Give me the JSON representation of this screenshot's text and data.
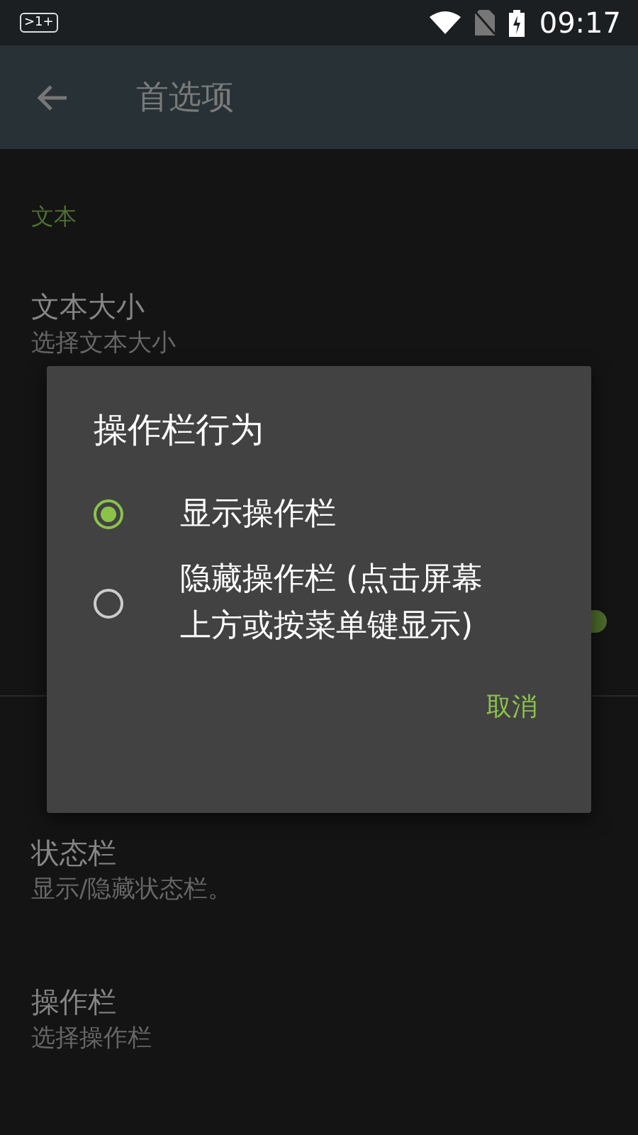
{
  "status_bar": {
    "notification_badge": ">1+",
    "time": "09:17"
  },
  "app_bar": {
    "title": "首选项"
  },
  "sections": [
    {
      "header": "文本",
      "items": [
        {
          "title": "文本大小",
          "subtitle": "选择文本大小"
        },
        {
          "switch": {
            "on": true
          }
        }
      ]
    },
    {
      "items": [
        {
          "title": "状态栏",
          "subtitle": "显示/隐藏状态栏。"
        },
        {
          "title": "操作栏",
          "subtitle": "选择操作栏"
        }
      ]
    }
  ],
  "dialog": {
    "title": "操作栏行为",
    "options": [
      {
        "label": "显示操作栏",
        "selected": true
      },
      {
        "label": "隐藏操作栏 (点击屏幕上方或按菜单键显示)",
        "selected": false
      }
    ],
    "buttons": [
      "取消"
    ]
  }
}
